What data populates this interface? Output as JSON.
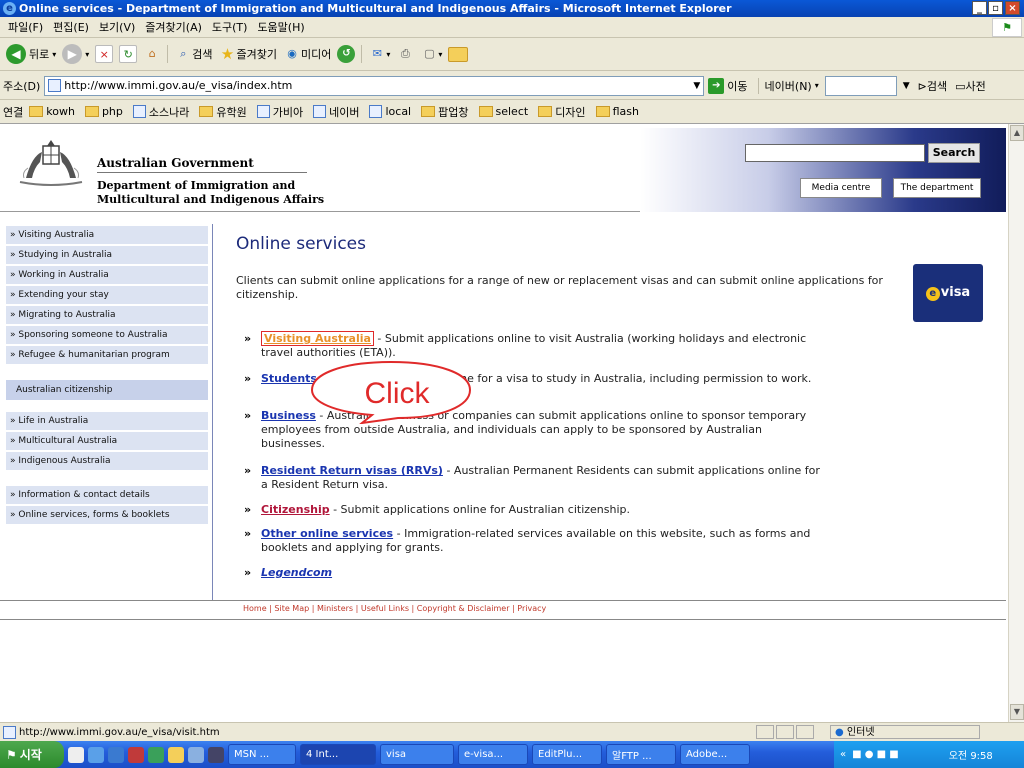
{
  "window": {
    "title": "Online services - Department of Immigration and Multicultural and Indigenous Affairs - Microsoft Internet Explorer",
    "minimize": "_",
    "maximize": "▫",
    "close": "×"
  },
  "menubar": [
    "파일(F)",
    "편집(E)",
    "보기(V)",
    "즐겨찾기(A)",
    "도구(T)",
    "도움말(H)"
  ],
  "toolbar": {
    "back": "뒤로",
    "search": "검색",
    "favorites": "즐겨찾기",
    "media": "미디어"
  },
  "addressbar": {
    "label": "주소(D)",
    "url": "http://www.immi.gov.au/e_visa/index.htm",
    "go": "이동",
    "naver": "네이버(N)",
    "search": "검색",
    "dictionary": "사전"
  },
  "linksbar": {
    "label": "연결",
    "items": [
      "kowh",
      "php",
      "소스나라",
      "유학원",
      "가비아",
      "네이버",
      "local",
      "팝업창",
      "select",
      "디자인",
      "flash"
    ]
  },
  "header": {
    "gov_name": "Australian Government",
    "dept_line1": "Department of Immigration and",
    "dept_line2": "Multicultural and Indigenous Affairs",
    "search_button": "Search",
    "media_centre": "Media centre",
    "the_department": "The department"
  },
  "nav": {
    "group1": [
      "» Visiting Australia",
      "» Studying in Australia",
      "» Working in Australia",
      "» Extending your stay",
      "» Migrating to Australia",
      "» Sponsoring someone to Australia",
      "» Refugee & humanitarian program"
    ],
    "citizenship": "Australian citizenship",
    "group2": [
      "» Life in Australia",
      "» Multicultural Australia",
      "» Indigenous Australia"
    ],
    "group3": [
      "» Information & contact details",
      "» Online services, forms & booklets"
    ]
  },
  "main": {
    "heading": "Online services",
    "intro_line1": "Clients can submit online applications for a range of new or replacement visas and can submit online applications for",
    "intro_line2": "citizenship.",
    "evisa_logo": "visa",
    "services": [
      {
        "link": "Visiting Australia",
        "text": " - Submit applications online to visit Australia (working holidays and electronic travel authorities (ETA))."
      },
      {
        "link": "Students",
        "text": " - Submit applications online for a visa to study in Australia, including permission to work."
      },
      {
        "link": "Business",
        "text": " - Australian business or companies can submit applications online to sponsor temporary employees from outside Australia, and individuals can apply to be sponsored by Australian businesses."
      },
      {
        "link": "Resident Return visas (RRVs)",
        "text": " - Australian Permanent Residents can submit applications online for a Resident Return visa."
      },
      {
        "link": "Citizenship",
        "text": " - Submit applications online for Australian citizenship."
      },
      {
        "link": "Other online services",
        "text": " - Immigration-related services available on this website, such as forms and booklets and applying for grants."
      },
      {
        "link": "Legendcom",
        "text": ""
      }
    ],
    "footer": "Home | Site Map | Ministers | Useful Links | Copyright & Disclaimer | Privacy"
  },
  "callout": "Click",
  "statusbar": {
    "url": "http://www.immi.gov.au/e_visa/visit.htm",
    "zone": "인터넷"
  },
  "taskbar": {
    "start": "시작",
    "tasks": [
      "MSN ...",
      "4 Int...",
      "visa",
      "e-visa...",
      "EditPlu...",
      "알FTP ...",
      "Adobe..."
    ],
    "clock": "오전 9:58"
  }
}
